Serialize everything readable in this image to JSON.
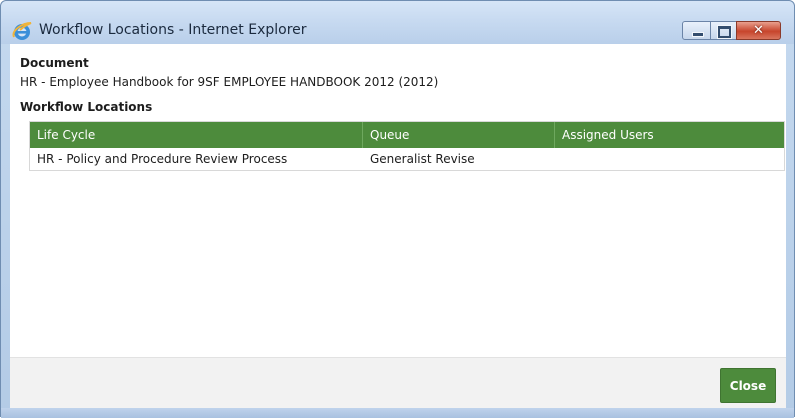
{
  "window": {
    "title": "Workflow Locations - Internet Explorer",
    "icon": "internet-explorer-icon"
  },
  "document": {
    "label": "Document",
    "value": "HR - Employee Handbook for 9SF EMPLOYEE HANDBOOK 2012 (2012)"
  },
  "workflow_locations": {
    "label": "Workflow Locations",
    "columns": [
      "Life Cycle",
      "Queue",
      "Assigned Users"
    ],
    "rows": [
      [
        "HR - Policy and Procedure Review Process",
        "Generalist Revise",
        ""
      ]
    ]
  },
  "footer": {
    "close_label": "Close"
  },
  "colors": {
    "accent_green": "#4d8b3c",
    "close_red": "#c7452c",
    "frame_blue": "#c5d9ef"
  }
}
